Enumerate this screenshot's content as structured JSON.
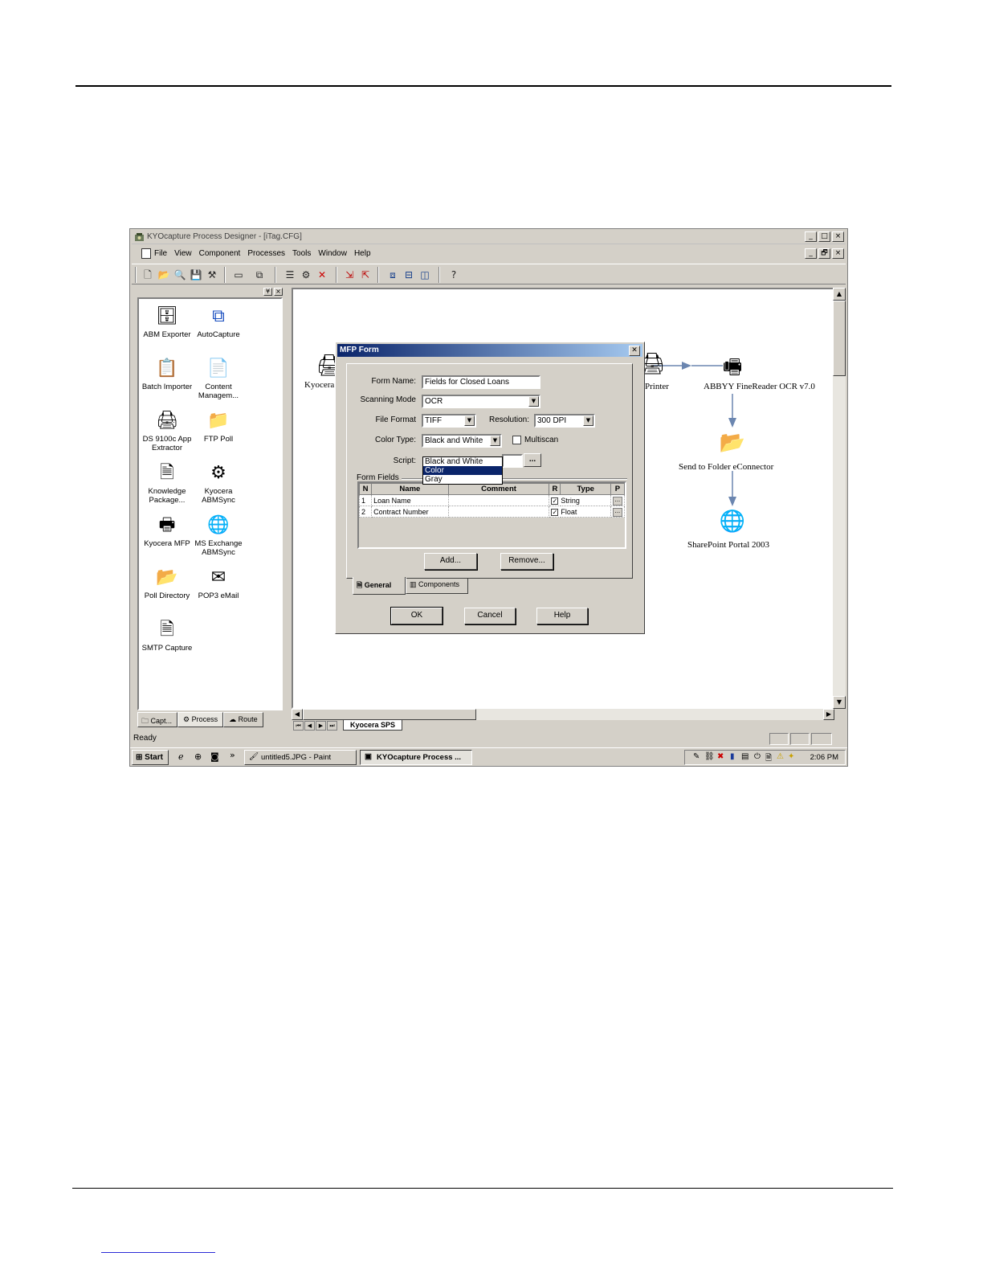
{
  "window": {
    "title": "KYOcapture Process Designer - [iTag.CFG]",
    "buttons": [
      "_",
      "□",
      "×"
    ],
    "mdi_buttons": [
      "_",
      "🗗",
      "×"
    ]
  },
  "menu": [
    "File",
    "View",
    "Component",
    "Processes",
    "Tools",
    "Window",
    "Help"
  ],
  "panel": {
    "items": [
      {
        "label": "ABM Exporter",
        "icon": "abm-exporter-icon"
      },
      {
        "label": "AutoCapture",
        "icon": "autocapture-icon"
      },
      {
        "label": "Batch Importer",
        "icon": "batch-importer-icon"
      },
      {
        "label": "Content Managem...",
        "icon": "content-management-icon"
      },
      {
        "label": "DS 9100c App Extractor",
        "icon": "ds9100c-icon"
      },
      {
        "label": "FTP Poll",
        "icon": "ftp-poll-icon"
      },
      {
        "label": "Knowledge Package...",
        "icon": "knowledge-package-icon"
      },
      {
        "label": "Kyocera ABMSync",
        "icon": "kyocera-abmsync-icon"
      },
      {
        "label": "Kyocera MFP",
        "icon": "kyocera-mfp-icon"
      },
      {
        "label": "MS Exchange ABMSync",
        "icon": "ms-exchange-icon"
      },
      {
        "label": "Poll Directory",
        "icon": "poll-directory-icon"
      },
      {
        "label": "POP3 eMail",
        "icon": "pop3-icon"
      },
      {
        "label": "SMTP Capture",
        "icon": "smtp-capture-icon"
      }
    ],
    "tabs": [
      "Capt...",
      "Process",
      "Route"
    ]
  },
  "canvas": {
    "nodes": [
      {
        "label": "Kyocera"
      },
      {
        "label": "Printer"
      },
      {
        "label": "ABBYY FineReader OCR v7.0"
      },
      {
        "label": "Send to Folder eConnector"
      },
      {
        "label": "SharePoint Portal 2003"
      }
    ],
    "sheet_tab": "Kyocera SPS"
  },
  "status": {
    "text": "Ready"
  },
  "taskbar": {
    "start": "Start",
    "chevron": "»",
    "tasks": [
      "untitled5.JPG - Paint",
      "KYOcapture Process ..."
    ],
    "clock": "2:06 PM"
  },
  "dialog": {
    "title": "MFP Form",
    "form_name_label": "Form Name:",
    "form_name_value": "Fields for Closed Loans",
    "scanning_mode_label": "Scanning Mode",
    "scanning_mode_value": "OCR",
    "file_format_label": "File Format",
    "file_format_value": "TIFF",
    "resolution_label": "Resolution:",
    "resolution_value": "300 DPI",
    "color_type_label": "Color Type:",
    "color_type_value": "Black and White",
    "color_type_options": [
      "Black and White",
      "Color",
      "Gray"
    ],
    "color_type_highlighted": "Color",
    "multiscan_label": "Multiscan",
    "multiscan_checked": false,
    "script_label": "Script:",
    "script_button": "...",
    "form_fields_label": "Form Fields",
    "columns": [
      "N",
      "Name",
      "Comment",
      "R",
      "Type",
      "P"
    ],
    "rows": [
      {
        "n": "1",
        "name": "Loan Name",
        "comment": "",
        "required": true,
        "type": "String",
        "p": "..."
      },
      {
        "n": "2",
        "name": "Contract Number",
        "comment": "",
        "required": true,
        "type": "Float",
        "p": "..."
      }
    ],
    "add_button": "Add...",
    "remove_button": "Remove...",
    "tabs": [
      "General",
      "Components"
    ],
    "ok": "OK",
    "cancel": "Cancel",
    "help": "Help"
  }
}
